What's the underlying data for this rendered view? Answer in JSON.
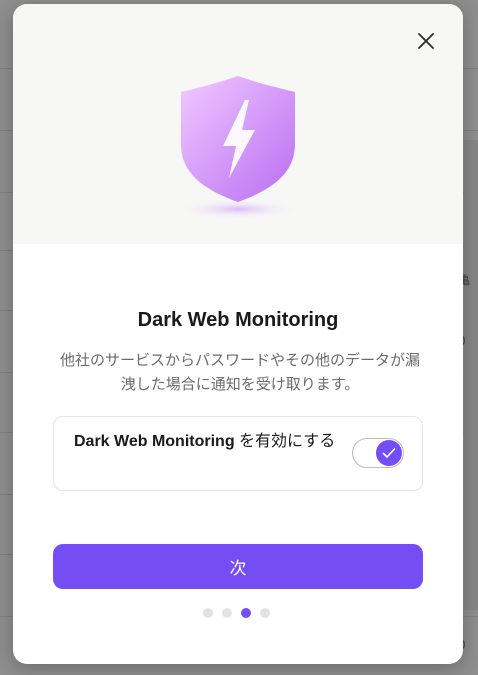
{
  "background": {
    "glyphs": [
      "亀",
      "0",
      "0"
    ]
  },
  "modal": {
    "close_icon": "close-icon",
    "illustration_icon": "shield-lightning-icon",
    "title": "Dark Web Monitoring",
    "description": "他社のサービスからパスワードやその他のデータが漏洩した場合に通知を受け取ります。",
    "toggle": {
      "label_strong": "Dark Web Monitoring",
      "label_rest": " を有効にする",
      "state": "on",
      "check_icon": "check-icon"
    },
    "next_button": "次",
    "pagination": {
      "total": 4,
      "current": 3
    }
  },
  "colors": {
    "accent": "#744df5",
    "shield_light": "#f1c9ff",
    "shield_dark": "#b96df2",
    "hero_bg": "#f7f7f6"
  }
}
